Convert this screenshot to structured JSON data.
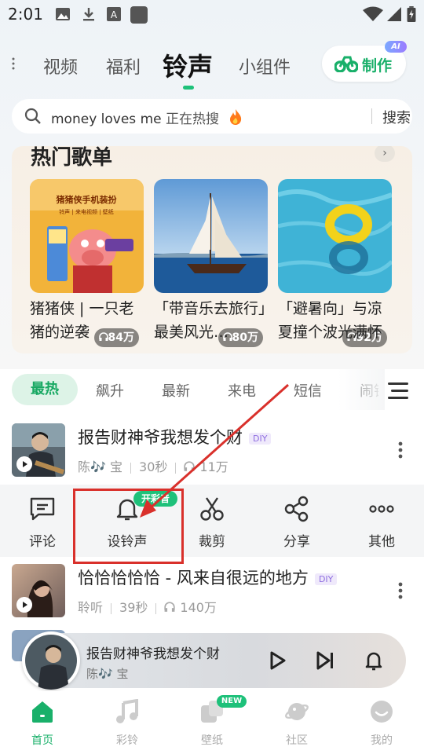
{
  "status_bar": {
    "time": "2:01"
  },
  "top_nav": {
    "tabs": [
      "视频",
      "福利",
      "铃声",
      "小组件"
    ],
    "active_tab": "铃声",
    "make_button": {
      "label": "制作",
      "badge": "AI"
    }
  },
  "search": {
    "query": "money loves me",
    "hint": "正在热搜",
    "button": "搜索"
  },
  "hot_songs": {
    "title": "热门歌单",
    "items": [
      {
        "title": "猪猪侠 | 一只老猪的逆袭",
        "plays": "84万",
        "cover_text": "猪猪侠手机装扮",
        "cover_sub": "铃声 | 来电视频 | 壁纸"
      },
      {
        "title": "「带音乐去旅行」最美风光…",
        "plays": "80万"
      },
      {
        "title": "「避暑向」与凉夏撞个波光满怀",
        "plays": "92万"
      }
    ]
  },
  "categories": {
    "tabs": [
      "最热",
      "飙升",
      "最新",
      "来电",
      "短信",
      "闹钟"
    ],
    "active": "最热"
  },
  "list": [
    {
      "title": "报告财神爷我想发个财",
      "badge": "DIY",
      "artist": "陈🎶 宝",
      "duration": "30秒",
      "plays": "11万"
    },
    {
      "title": "恰恰恰恰恰 - 风来自很远的地方",
      "badge": "DIY",
      "artist": "聆听",
      "duration": "39秒",
      "plays": "140万"
    }
  ],
  "actions": [
    {
      "label": "评论",
      "icon": "comment-icon"
    },
    {
      "label": "设铃声",
      "icon": "bell-icon",
      "badge": "开彩音"
    },
    {
      "label": "裁剪",
      "icon": "scissors-icon"
    },
    {
      "label": "分享",
      "icon": "share-icon"
    },
    {
      "label": "其他",
      "icon": "more-icon"
    }
  ],
  "mini_player": {
    "title": "报告财神爷我想发个财",
    "artist": "陈🎶 宝"
  },
  "bottom_nav": {
    "items": [
      "首页",
      "彩铃",
      "壁纸",
      "社区",
      "我的"
    ],
    "active": "首页",
    "new_badge": "NEW"
  },
  "colors": {
    "accent": "#1ec17a",
    "highlight": "#d9302b"
  }
}
